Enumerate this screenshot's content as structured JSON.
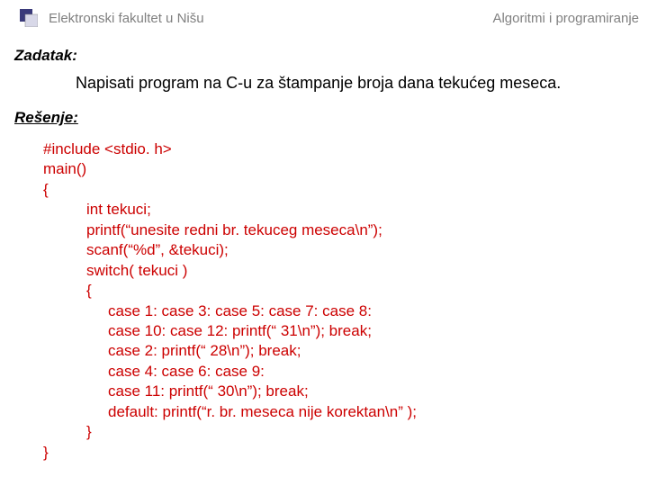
{
  "header": {
    "left": "Elektronski fakultet u Nišu",
    "right": "Algoritmi i programiranje"
  },
  "labels": {
    "task": "Zadatak:",
    "solution": "Rešenje:"
  },
  "task_text": "Napisati program na C-u za štampanje broja dana tekućeg meseca.",
  "code": {
    "l1": "#include <stdio. h>",
    "l2": "main()",
    "l3": "{",
    "l4": "int tekuci;",
    "l5": "printf(“unesite redni br. tekuceg meseca\\n”);",
    "l6": "scanf(“%d”, &tekuci);",
    "l7": "switch( tekuci )",
    "l8": "{",
    "l9": "case 1: case 3: case 5: case 7: case 8:",
    "l10": "case 10: case 12: printf(“ 31\\n”); break;",
    "l11": "case 2: printf(“ 28\\n”); break;",
    "l12": "case 4: case 6: case 9:",
    "l13": "case 11: printf(“ 30\\n”); break;",
    "l14": "default: printf(“r. br. meseca nije korektan\\n” );",
    "l15": "}",
    "l16": "}"
  }
}
